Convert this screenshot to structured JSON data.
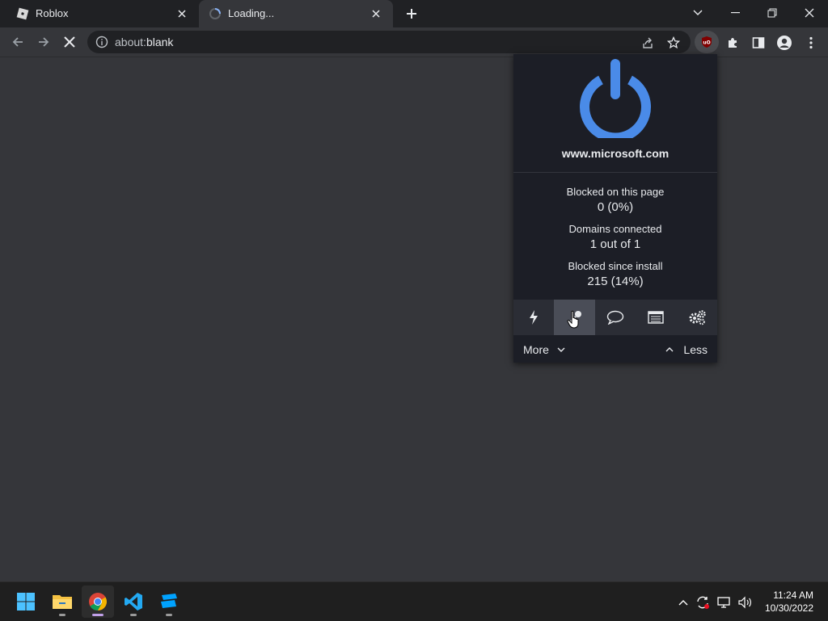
{
  "browser": {
    "tabs": [
      {
        "title": "Roblox",
        "favicon": "roblox-icon",
        "active": false
      },
      {
        "title": "Loading...",
        "favicon": "loading-spinner-icon",
        "active": true
      }
    ],
    "address_bar": {
      "url_prefix": "about:",
      "url_host": "blank"
    }
  },
  "ublock_popup": {
    "hostname": "www.microsoft.com",
    "power_state": "enabled",
    "stats": [
      {
        "label": "Blocked on this page",
        "value": "0 (0%)"
      },
      {
        "label": "Domains connected",
        "value": "1 out of 1"
      },
      {
        "label": "Blocked since install",
        "value": "215 (14%)"
      }
    ],
    "tools": [
      "lightning-icon",
      "eyedropper-icon",
      "speech-bubble-icon",
      "logger-icon",
      "gears-icon"
    ],
    "more_label": "More",
    "less_label": "Less"
  },
  "taskbar": {
    "apps": [
      "windows-start-icon",
      "file-explorer-icon",
      "chrome-icon",
      "vscode-icon",
      "roblox-studio-icon"
    ],
    "clock": {
      "time": "11:24 AM",
      "date": "10/30/2022"
    }
  },
  "colors": {
    "page_bg": "#35363a",
    "tabstrip_bg": "#202124",
    "popup_bg": "#1c1e26",
    "power_blue": "#4a8be8",
    "ubo_red": "#800000"
  }
}
